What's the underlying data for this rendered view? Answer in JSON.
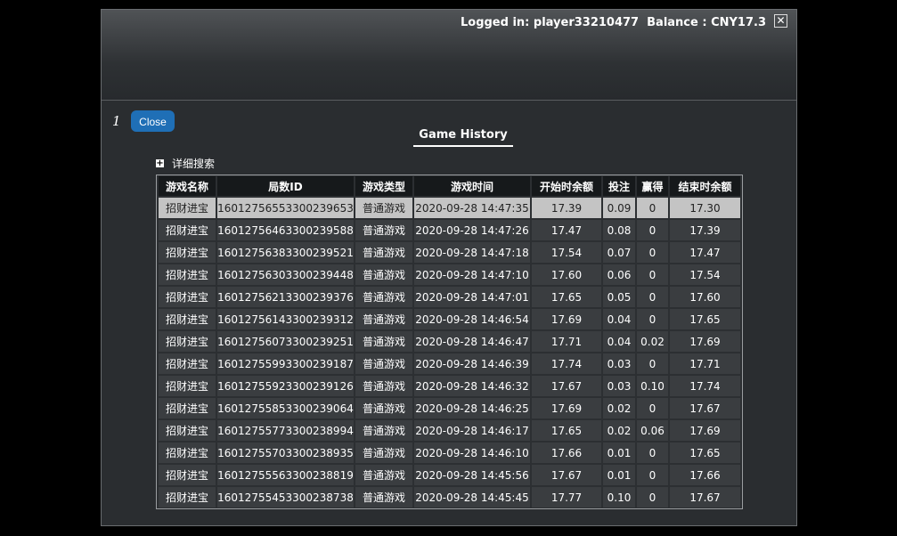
{
  "header": {
    "login_text": "Logged in: player33210477  Balance : CNY17.3",
    "close_icon": "close-icon"
  },
  "toolbar": {
    "page_number": "1",
    "close_label": "Close"
  },
  "title": "Game History",
  "search_toggle": {
    "label": "详细搜索",
    "icon": "plus-icon"
  },
  "table": {
    "columns": [
      "游戏名称",
      "局数ID",
      "游戏类型",
      "游戏时间",
      "开始时余额",
      "投注",
      "赢得",
      "结束时余额"
    ],
    "selected_row": 0,
    "rows": [
      [
        "招财进宝",
        "16012756553300239653",
        "普通游戏",
        "2020-09-28 14:47:35",
        "17.39",
        "0.09",
        "0",
        "17.30"
      ],
      [
        "招财进宝",
        "16012756463300239588",
        "普通游戏",
        "2020-09-28 14:47:26",
        "17.47",
        "0.08",
        "0",
        "17.39"
      ],
      [
        "招财进宝",
        "16012756383300239521",
        "普通游戏",
        "2020-09-28 14:47:18",
        "17.54",
        "0.07",
        "0",
        "17.47"
      ],
      [
        "招财进宝",
        "16012756303300239448",
        "普通游戏",
        "2020-09-28 14:47:10",
        "17.60",
        "0.06",
        "0",
        "17.54"
      ],
      [
        "招财进宝",
        "16012756213300239376",
        "普通游戏",
        "2020-09-28 14:47:01",
        "17.65",
        "0.05",
        "0",
        "17.60"
      ],
      [
        "招财进宝",
        "16012756143300239312",
        "普通游戏",
        "2020-09-28 14:46:54",
        "17.69",
        "0.04",
        "0",
        "17.65"
      ],
      [
        "招财进宝",
        "16012756073300239251",
        "普通游戏",
        "2020-09-28 14:46:47",
        "17.71",
        "0.04",
        "0.02",
        "17.69"
      ],
      [
        "招财进宝",
        "16012755993300239187",
        "普通游戏",
        "2020-09-28 14:46:39",
        "17.74",
        "0.03",
        "0",
        "17.71"
      ],
      [
        "招财进宝",
        "16012755923300239126",
        "普通游戏",
        "2020-09-28 14:46:32",
        "17.67",
        "0.03",
        "0.10",
        "17.74"
      ],
      [
        "招财进宝",
        "16012755853300239064",
        "普通游戏",
        "2020-09-28 14:46:25",
        "17.69",
        "0.02",
        "0",
        "17.67"
      ],
      [
        "招财进宝",
        "16012755773300238994",
        "普通游戏",
        "2020-09-28 14:46:17",
        "17.65",
        "0.02",
        "0.06",
        "17.69"
      ],
      [
        "招财进宝",
        "16012755703300238935",
        "普通游戏",
        "2020-09-28 14:46:10",
        "17.66",
        "0.01",
        "0",
        "17.65"
      ],
      [
        "招财进宝",
        "16012755563300238819",
        "普通游戏",
        "2020-09-28 14:45:56",
        "17.67",
        "0.01",
        "0",
        "17.66"
      ],
      [
        "招财进宝",
        "16012755453300238738",
        "普通游戏",
        "2020-09-28 14:45:45",
        "17.77",
        "0.10",
        "0",
        "17.67"
      ]
    ]
  }
}
